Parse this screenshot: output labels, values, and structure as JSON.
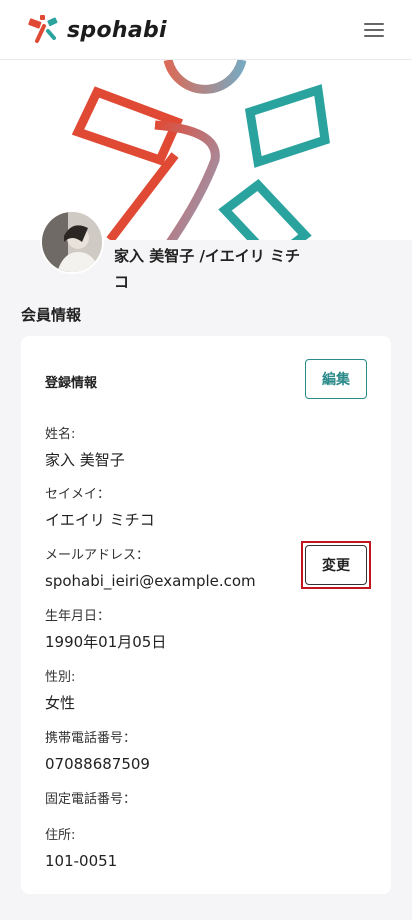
{
  "header": {
    "brand": "spohabi",
    "logo_icon": "spohabi-logo-icon",
    "menu_icon": "hamburger-menu-icon"
  },
  "profile": {
    "name": "家入 美智子 /イエイリ ミチコ",
    "avatar": "user-avatar-photo"
  },
  "section": {
    "title": "会員情報"
  },
  "card": {
    "title": "登録情報",
    "edit_label": "編集",
    "change_label": "変更",
    "fields": [
      {
        "label": "姓名:",
        "value": "家入 美智子"
      },
      {
        "label": "セイメイ：",
        "value": "イエイリ ミチコ"
      },
      {
        "label": "メールアドレス：",
        "value": "spohabi_ieiri@example.com"
      },
      {
        "label": "生年月日：",
        "value": "1990年01月05日"
      },
      {
        "label": "性別:",
        "value": "女性"
      },
      {
        "label": "携帯電話番号：",
        "value": "07088687509"
      },
      {
        "label": "固定電話番号：",
        "value": ""
      },
      {
        "label": "住所:",
        "value": "101-0051"
      }
    ]
  },
  "colors": {
    "accent": "#2b8a8a",
    "red": "#e04a35",
    "highlight_border": "#c0161d",
    "page_bg": "#f5f5f7"
  }
}
